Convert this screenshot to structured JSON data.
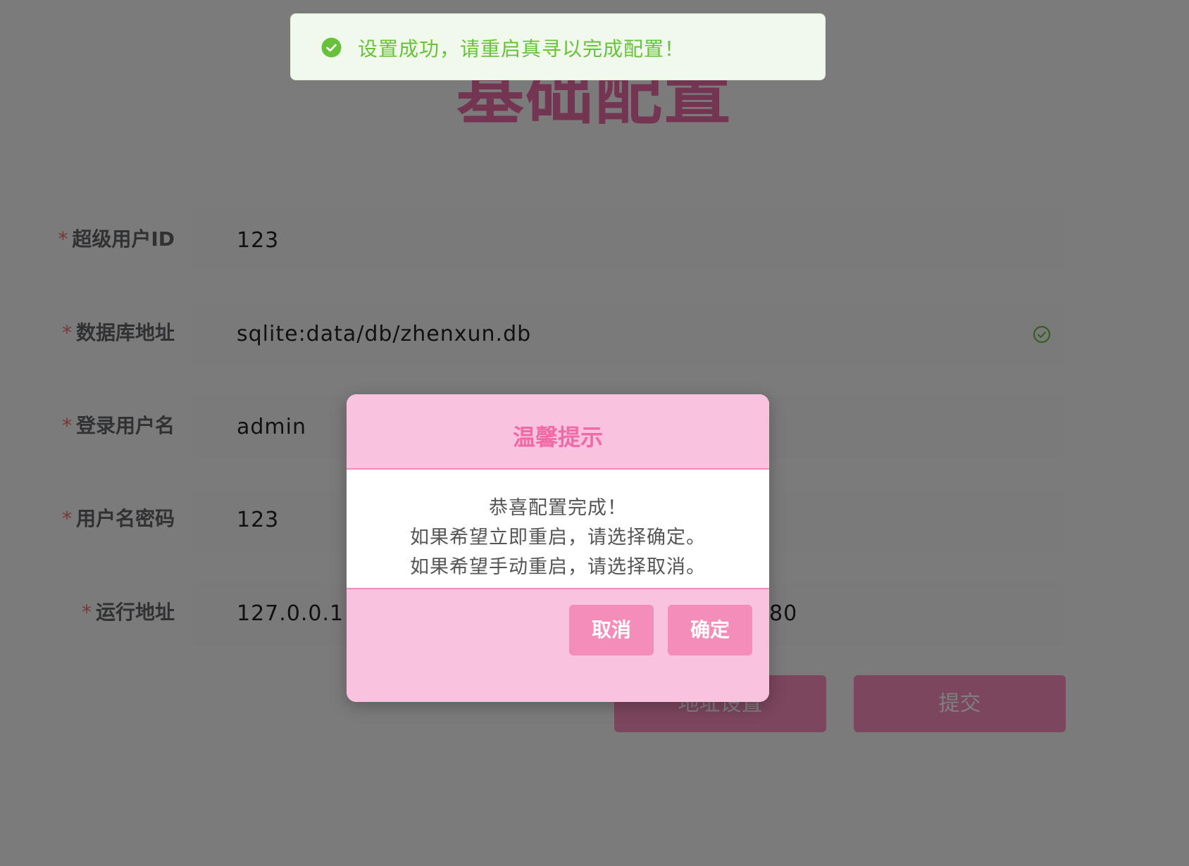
{
  "page": {
    "title": "基础配置",
    "fields": [
      {
        "label": "超级用户ID",
        "value": "123"
      },
      {
        "label": "数据库地址",
        "value": "sqlite:data/db/zhenxun.db"
      },
      {
        "label": "登录用户名",
        "value": "admin"
      },
      {
        "label": "用户名密码",
        "value": "123"
      },
      {
        "label": "运行地址",
        "host": "127.0.0.1",
        "port": "80"
      }
    ],
    "required_mark": "*",
    "buttons": {
      "address_settings": "地址设置",
      "submit": "提交"
    }
  },
  "toast": {
    "message": "设置成功，请重启真寻以完成配置！",
    "icon": "check-circle-icon"
  },
  "dialog": {
    "title": "温馨提示",
    "lines": [
      "恭喜配置完成！",
      "如果希望立即重启，请选择确定。",
      "如果希望手动重启，请选择取消。"
    ],
    "cancel_label": "取消",
    "confirm_label": "确定"
  },
  "colors": {
    "accent": "#f58dbb",
    "dialog_bg": "#f9c2df",
    "success": "#67c23a",
    "required": "#f56c6c"
  }
}
